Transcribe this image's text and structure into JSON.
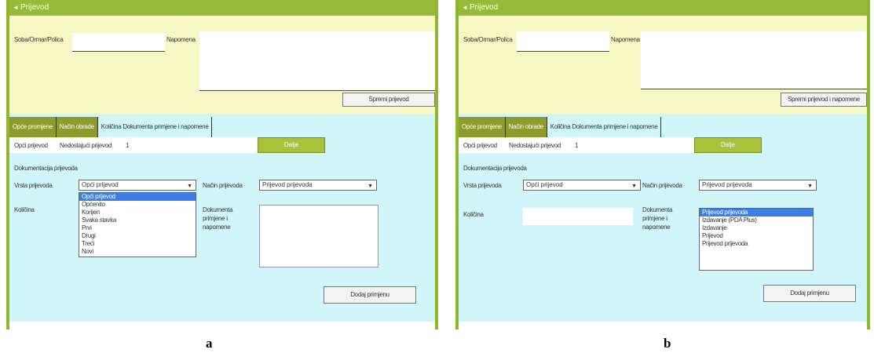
{
  "panel_a": {
    "header_title": "Prijevod",
    "field_location_label": "Soba/Ormar/Polica",
    "field_note_label": "Napomena",
    "save_button": "Spremi prijevod",
    "tabs": [
      "Opće promjene",
      "Način obrade",
      "Količina Dokumenta primjene i napomene"
    ],
    "info_label": "Opći prijevod",
    "info_label2": "Nedostajući prijevod",
    "info_value": "1",
    "green_button": "Dalje",
    "section_title": "Dokumentacija prijevoda",
    "type_label": "Vrsta prijevoda",
    "type_value": "Opći prijevod",
    "type_options": [
      "Opći prijevod",
      "Općenito",
      "Korijen",
      "Svaka stavka",
      "Prvi",
      "Drugi",
      "Treći",
      "Novi"
    ],
    "mode_label": "Način prijevoda",
    "mode_value": "Prijevod prijevoda",
    "qty_label": "Količina",
    "doc_label": [
      "Dokumenta",
      "primjene i",
      "napomene"
    ],
    "add_button": "Dodaj primjenu"
  },
  "panel_b": {
    "header_title": "Prijevod",
    "field_location_label": "Soba/Ormar/Polica",
    "field_note_label": "Napomena",
    "save_button": "Spremi prijevod i napomene",
    "tabs": [
      "Opće promjene",
      "Način obrade",
      "Količina Dokumenta primjene i napomene"
    ],
    "info_label": "Opći prijevod",
    "info_label2": "Nedostajući prijevod",
    "info_value": "1",
    "green_button": "Dalje",
    "section_title": "Dokumentacija prijevoda",
    "type_label": "Vrsta prijevoda",
    "type_value": "Opći prijevod",
    "mode_label": "Način prijevoda",
    "mode_value": "Prijevod prijevoda",
    "mode_options": [
      "Prijevod prijevoda",
      "Izdavanje (PDA Plus)",
      "Izdavanje",
      "Prijevod",
      "Prijevod prijevoda"
    ],
    "qty_label": "Količina",
    "doc_label": [
      "Dokumenta",
      "primjene i",
      "napomene"
    ],
    "add_button": "Dodaj primjenu"
  },
  "captions": {
    "a": "a",
    "b": "b"
  }
}
